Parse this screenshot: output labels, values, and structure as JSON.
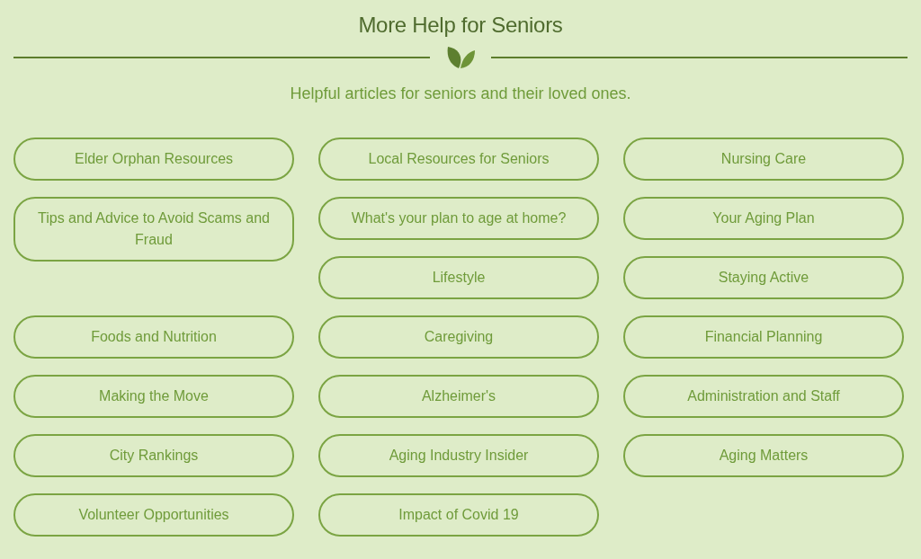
{
  "heading": "More Help for Seniors",
  "subheading": "Helpful articles for seniors and their loved ones.",
  "links": [
    {
      "label": "Elder Orphan Resources"
    },
    {
      "label": "Local Resources for Seniors"
    },
    {
      "label": "Nursing Care"
    },
    {
      "label": "Tips and Advice to Avoid Scams and Fraud"
    },
    {
      "label": "What's your plan to age at home?"
    },
    {
      "label": "Your Aging Plan"
    },
    {
      "label": "Lifestyle"
    },
    {
      "label": "Staying Active"
    },
    {
      "label": "Foods and Nutrition"
    },
    {
      "label": "Caregiving"
    },
    {
      "label": "Financial Planning"
    },
    {
      "label": "Making the Move"
    },
    {
      "label": "Alzheimer's"
    },
    {
      "label": "Administration and Staff"
    },
    {
      "label": "City Rankings"
    },
    {
      "label": "Aging Industry Insider"
    },
    {
      "label": "Aging Matters"
    },
    {
      "label": "Volunteer Opportunities"
    },
    {
      "label": "Impact of Covid 19"
    }
  ]
}
